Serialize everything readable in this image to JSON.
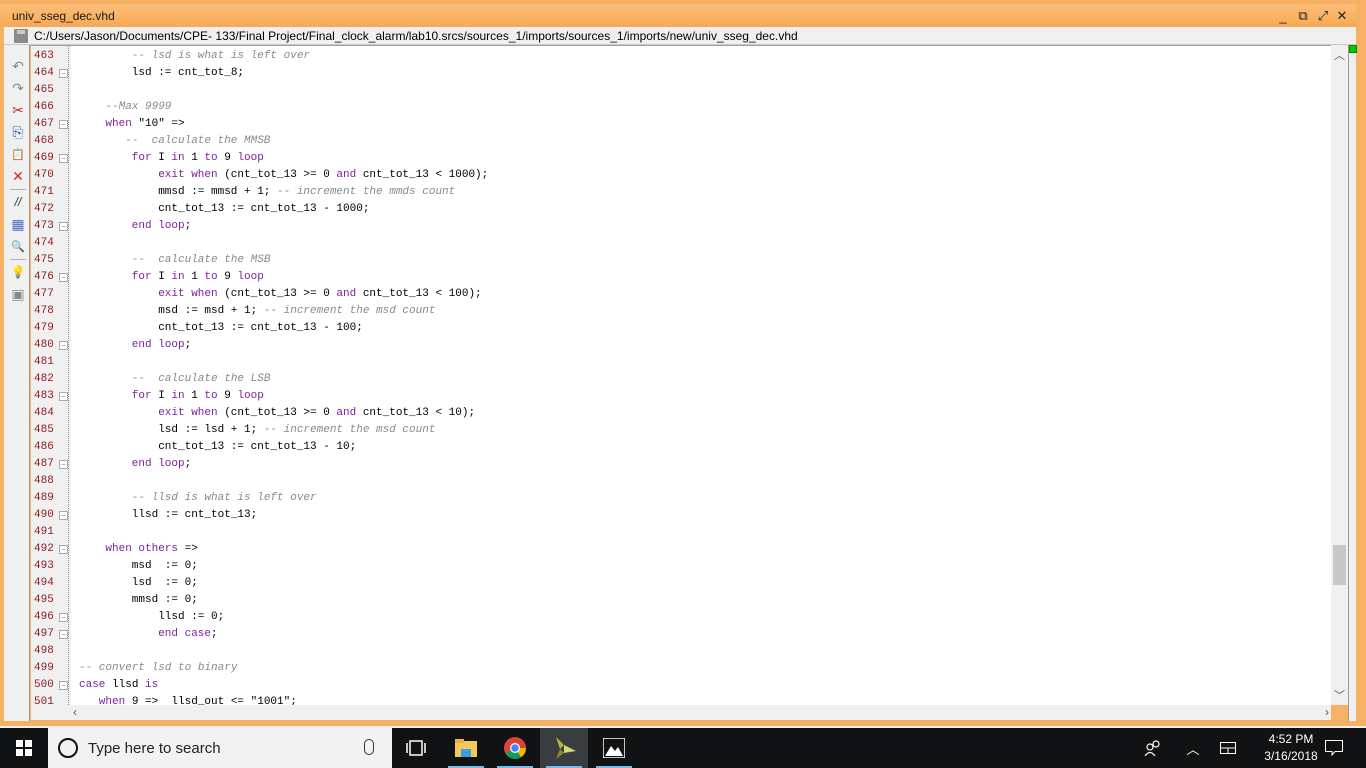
{
  "window": {
    "title": "univ_sseg_dec.vhd",
    "path": "C:/Users/Jason/Documents/CPE- 133/Final Project/Final_clock_alarm/lab10.srcs/sources_1/imports/sources_1/imports/new/univ_sseg_dec.vhd",
    "controls": {
      "minimize": "_",
      "restore": "⧉",
      "float": "⤢",
      "close": "✕"
    }
  },
  "toolbar": {
    "items": [
      {
        "name": "undo-icon",
        "glyph": "↶"
      },
      {
        "name": "redo-icon",
        "glyph": "↷"
      },
      {
        "name": "cut-icon",
        "glyph": "✂"
      },
      {
        "name": "copy-icon",
        "glyph": "⎘"
      },
      {
        "name": "paste-icon",
        "glyph": "📋"
      },
      {
        "name": "delete-icon",
        "glyph": "✕"
      },
      {
        "name": "comment-icon",
        "glyph": "//"
      },
      {
        "name": "select-all-icon",
        "glyph": "▦"
      },
      {
        "name": "find-icon",
        "glyph": "🔍"
      },
      {
        "name": "hint-bulb-icon",
        "glyph": "💡"
      },
      {
        "name": "insert-template-icon",
        "glyph": "▣"
      }
    ]
  },
  "editor": {
    "lines": [
      {
        "n": "463",
        "fold": "",
        "indent": 8,
        "parts": [
          [
            "cm",
            "-- lsd is what is left over"
          ]
        ]
      },
      {
        "n": "464",
        "fold": "end",
        "indent": 8,
        "parts": [
          [
            "",
            "lsd := cnt_tot_8;"
          ]
        ]
      },
      {
        "n": "465",
        "fold": "",
        "indent": 0,
        "parts": []
      },
      {
        "n": "466",
        "fold": "",
        "indent": 4,
        "parts": [
          [
            "cm",
            "--Max 9999"
          ]
        ]
      },
      {
        "n": "467",
        "fold": "start",
        "indent": 4,
        "parts": [
          [
            "kw",
            "when "
          ],
          [
            "",
            "\"10\" =>"
          ]
        ]
      },
      {
        "n": "468",
        "fold": "",
        "indent": 7,
        "parts": [
          [
            "cm",
            "--  calculate the MMSB"
          ]
        ]
      },
      {
        "n": "469",
        "fold": "start",
        "indent": 8,
        "parts": [
          [
            "kw",
            "for "
          ],
          [
            "",
            "I "
          ],
          [
            "kw",
            "in "
          ],
          [
            "",
            "1 "
          ],
          [
            "kw",
            "to "
          ],
          [
            "",
            "9 "
          ],
          [
            "kw",
            "loop"
          ]
        ]
      },
      {
        "n": "470",
        "fold": "",
        "indent": 12,
        "parts": [
          [
            "kw",
            "exit when "
          ],
          [
            "",
            "(cnt_tot_13 >= 0 "
          ],
          [
            "kw",
            "and "
          ],
          [
            "",
            "cnt_tot_13 < 1000);"
          ]
        ]
      },
      {
        "n": "471",
        "fold": "",
        "indent": 12,
        "parts": [
          [
            "",
            "mmsd := mmsd + 1; "
          ],
          [
            "cm",
            "-- increment the mmds count"
          ]
        ]
      },
      {
        "n": "472",
        "fold": "",
        "indent": 12,
        "parts": [
          [
            "",
            "cnt_tot_13 := cnt_tot_13 - 1000;"
          ]
        ]
      },
      {
        "n": "473",
        "fold": "end",
        "indent": 8,
        "parts": [
          [
            "kw",
            "end loop"
          ],
          [
            "",
            ";"
          ]
        ]
      },
      {
        "n": "474",
        "fold": "",
        "indent": 0,
        "parts": []
      },
      {
        "n": "475",
        "fold": "",
        "indent": 8,
        "parts": [
          [
            "cm",
            "--  calculate the MSB"
          ]
        ]
      },
      {
        "n": "476",
        "fold": "start",
        "indent": 8,
        "parts": [
          [
            "kw",
            "for "
          ],
          [
            "",
            "I "
          ],
          [
            "kw",
            "in "
          ],
          [
            "",
            "1 "
          ],
          [
            "kw",
            "to "
          ],
          [
            "",
            "9 "
          ],
          [
            "kw",
            "loop"
          ]
        ]
      },
      {
        "n": "477",
        "fold": "",
        "indent": 12,
        "parts": [
          [
            "kw",
            "exit when "
          ],
          [
            "",
            "(cnt_tot_13 >= 0 "
          ],
          [
            "kw",
            "and "
          ],
          [
            "",
            "cnt_tot_13 < 100);"
          ]
        ]
      },
      {
        "n": "478",
        "fold": "",
        "indent": 12,
        "parts": [
          [
            "",
            "msd := msd + 1; "
          ],
          [
            "cm",
            "-- increment the msd count"
          ]
        ]
      },
      {
        "n": "479",
        "fold": "",
        "indent": 12,
        "parts": [
          [
            "",
            "cnt_tot_13 := cnt_tot_13 - 100;"
          ]
        ]
      },
      {
        "n": "480",
        "fold": "end",
        "indent": 8,
        "parts": [
          [
            "kw",
            "end loop"
          ],
          [
            "",
            ";"
          ]
        ]
      },
      {
        "n": "481",
        "fold": "",
        "indent": 0,
        "parts": []
      },
      {
        "n": "482",
        "fold": "",
        "indent": 8,
        "parts": [
          [
            "cm",
            "--  calculate the LSB"
          ]
        ]
      },
      {
        "n": "483",
        "fold": "start",
        "indent": 8,
        "parts": [
          [
            "kw",
            "for "
          ],
          [
            "",
            "I "
          ],
          [
            "kw",
            "in "
          ],
          [
            "",
            "1 "
          ],
          [
            "kw",
            "to "
          ],
          [
            "",
            "9 "
          ],
          [
            "kw",
            "loop"
          ]
        ]
      },
      {
        "n": "484",
        "fold": "",
        "indent": 12,
        "parts": [
          [
            "kw",
            "exit when "
          ],
          [
            "",
            "(cnt_tot_13 >= 0 "
          ],
          [
            "kw",
            "and "
          ],
          [
            "",
            "cnt_tot_13 < 10);"
          ]
        ]
      },
      {
        "n": "485",
        "fold": "",
        "indent": 12,
        "parts": [
          [
            "",
            "lsd := lsd + 1; "
          ],
          [
            "cm",
            "-- increment the msd count"
          ]
        ]
      },
      {
        "n": "486",
        "fold": "",
        "indent": 12,
        "parts": [
          [
            "",
            "cnt_tot_13 := cnt_tot_13 - 10;"
          ]
        ]
      },
      {
        "n": "487",
        "fold": "end",
        "indent": 8,
        "parts": [
          [
            "kw",
            "end loop"
          ],
          [
            "",
            ";"
          ]
        ]
      },
      {
        "n": "488",
        "fold": "",
        "indent": 0,
        "parts": []
      },
      {
        "n": "489",
        "fold": "",
        "indent": 8,
        "parts": [
          [
            "cm",
            "-- llsd is what is left over"
          ]
        ]
      },
      {
        "n": "490",
        "fold": "end",
        "indent": 8,
        "parts": [
          [
            "",
            "llsd := cnt_tot_13;"
          ]
        ]
      },
      {
        "n": "491",
        "fold": "",
        "indent": 0,
        "parts": []
      },
      {
        "n": "492",
        "fold": "start",
        "indent": 4,
        "parts": [
          [
            "kw",
            "when others "
          ],
          [
            "",
            "=>"
          ]
        ]
      },
      {
        "n": "493",
        "fold": "",
        "indent": 8,
        "parts": [
          [
            "",
            "msd  := 0;"
          ]
        ]
      },
      {
        "n": "494",
        "fold": "",
        "indent": 8,
        "parts": [
          [
            "",
            "lsd  := 0;"
          ]
        ]
      },
      {
        "n": "495",
        "fold": "",
        "indent": 8,
        "parts": [
          [
            "",
            "mmsd := 0;"
          ]
        ]
      },
      {
        "n": "496",
        "fold": "end",
        "indent": 12,
        "parts": [
          [
            "",
            "llsd := 0;"
          ]
        ]
      },
      {
        "n": "497",
        "fold": "end",
        "indent": 12,
        "parts": [
          [
            "kw",
            "end case"
          ],
          [
            "",
            ";"
          ]
        ]
      },
      {
        "n": "498",
        "fold": "",
        "indent": 0,
        "parts": []
      },
      {
        "n": "499",
        "fold": "",
        "indent": 0,
        "parts": [
          [
            "cm",
            "-- convert lsd to binary"
          ]
        ]
      },
      {
        "n": "500",
        "fold": "start",
        "indent": 0,
        "parts": [
          [
            "kw",
            "case "
          ],
          [
            "",
            "llsd "
          ],
          [
            "kw",
            "is"
          ]
        ]
      },
      {
        "n": "501",
        "fold": "",
        "indent": 3,
        "parts": [
          [
            "kw",
            "when "
          ],
          [
            "",
            "9 =>  llsd_out <= \"1001\";"
          ]
        ]
      }
    ]
  },
  "taskbar": {
    "search_placeholder": "Type here to search",
    "apps": [
      {
        "name": "task-view",
        "active": false
      },
      {
        "name": "file-explorer",
        "active": false
      },
      {
        "name": "chrome",
        "active": false
      },
      {
        "name": "vivado",
        "active": true
      },
      {
        "name": "photos",
        "active": false
      }
    ],
    "time": "4:52 PM",
    "date": "3/16/2018"
  },
  "colors": {
    "window_border": "#f7b164",
    "keyword": "#7f1fa0",
    "comment": "#8a8a8a",
    "line_number": "#8b1a1a",
    "status_ok": "#00cc00"
  }
}
